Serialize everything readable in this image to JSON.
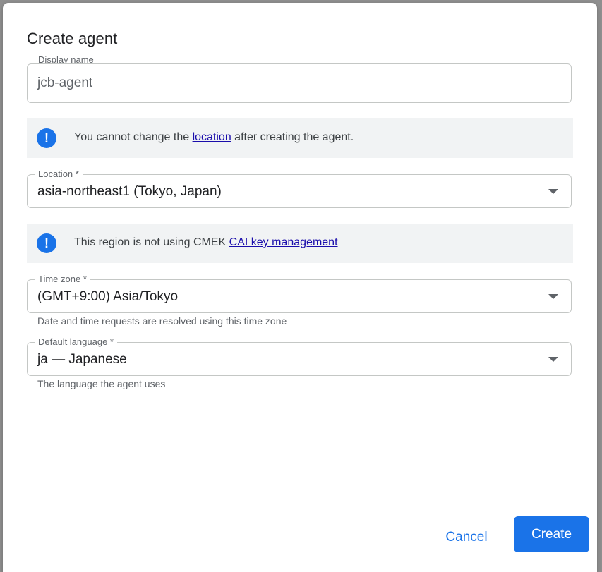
{
  "dialog": {
    "title": "Create agent"
  },
  "display_name": {
    "label": "Display name",
    "value": "jcb-agent"
  },
  "location_notice": {
    "icon": "info-icon",
    "text_before": "You cannot change the ",
    "link": "location",
    "text_after": " after creating the agent."
  },
  "location": {
    "label": "Location *",
    "value": "asia-northeast1 (Tokyo, Japan)"
  },
  "cmek_notice": {
    "icon": "info-icon",
    "text_before": "This region is not using CMEK ",
    "link": "CAI key management"
  },
  "time_zone": {
    "label": "Time zone *",
    "value": "(GMT+9:00) Asia/Tokyo",
    "helper": "Date and time requests are resolved using this time zone"
  },
  "default_language": {
    "label": "Default language *",
    "value": "ja — Japanese",
    "helper": "The language the agent uses"
  },
  "actions": {
    "cancel": "Cancel",
    "create": "Create"
  },
  "colors": {
    "primary": "#1a73e8",
    "link": "#1a0dab",
    "notice_bg": "#f1f3f4"
  }
}
